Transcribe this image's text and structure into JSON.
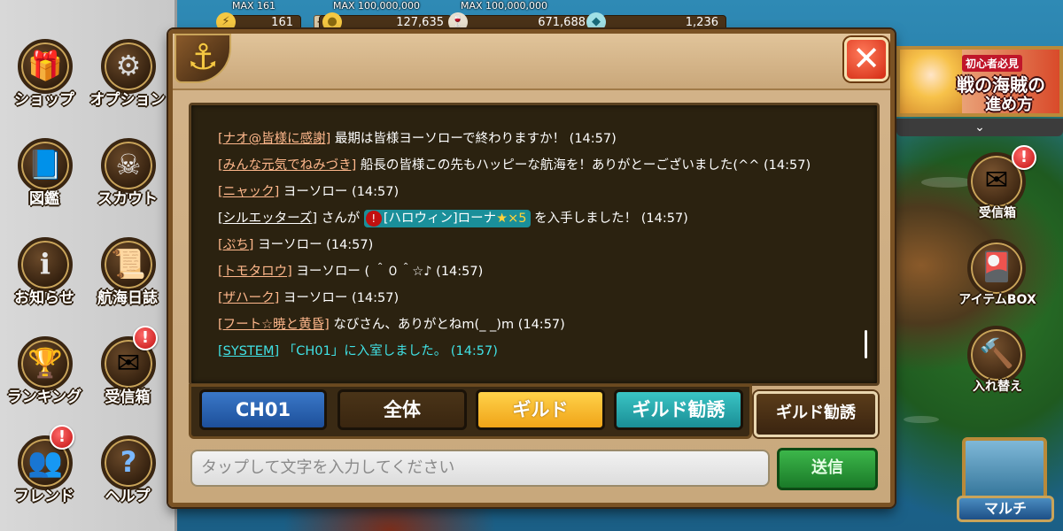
{
  "topbar": {
    "stamina": {
      "max_label": "MAX 161",
      "value": "161"
    },
    "gold": {
      "max_label": "MAX 100,000,000",
      "value": "127,635"
    },
    "wine": {
      "max_label": "MAX 100,000,000",
      "value": "671,688"
    },
    "gems": {
      "value": "1,236"
    }
  },
  "left_menu": [
    {
      "label": "ショップ",
      "icon": "shop-icon"
    },
    {
      "label": "オプション",
      "icon": "gear-icon"
    },
    {
      "label": "図鑑",
      "icon": "book-icon"
    },
    {
      "label": "スカウト",
      "icon": "pirate-flag-icon"
    },
    {
      "label": "お知らせ",
      "icon": "info-icon"
    },
    {
      "label": "航海日誌",
      "icon": "logbook-icon"
    },
    {
      "label": "ランキング",
      "icon": "trophy-icon"
    },
    {
      "label": "受信箱",
      "icon": "mail-icon",
      "badge": "!"
    },
    {
      "label": "フレンド",
      "icon": "friends-icon",
      "badge": "!"
    },
    {
      "label": "ヘルプ",
      "icon": "help-icon"
    }
  ],
  "banner": {
    "tag": "初心者必見",
    "line1": "戦の海賊の",
    "line2": "進め方"
  },
  "banner_toggle": "⌄",
  "right_menu": [
    {
      "label": "受信箱",
      "icon": "mail-icon",
      "badge": "!"
    },
    {
      "label": "アイテムBOX",
      "icon": "item-box-icon"
    },
    {
      "label": "入れ替え",
      "icon": "hammer-icon"
    }
  ],
  "multi": {
    "label": "マルチ"
  },
  "chat": {
    "messages": [
      {
        "name": "[ナオ@皆様に感謝]",
        "text": " 最期は皆様ヨーソローで終わりますか！ (14:57)"
      },
      {
        "name": "[みんな元気でねみづき]",
        "text": " 船長の皆様この先もハッピーな航海を！ありがとーございました(^^ (14:57)"
      },
      {
        "name": "[ニャック]",
        "text": " ヨーソロー (14:57)"
      },
      {
        "name": "[シルエッターズ]",
        "text_before": " さんが ",
        "item": "[ハロウィン]ローナ",
        "item_stars": "★×5",
        "text_after": " を入手しました！ (14:57)"
      },
      {
        "name": "[ぷち]",
        "text": " ヨーソロー (14:57)"
      },
      {
        "name": "[トモタロウ]",
        "text": " ヨーソロー ( ＾０＾☆♪ (14:57)"
      },
      {
        "name": "[ザハーク]",
        "text": " ヨーソロー (14:57)"
      },
      {
        "name": "[フート☆暁と黄昏]",
        "text": " なびさん、ありがとねm(_ _)m (14:57)"
      },
      {
        "name": "[SYSTEM]",
        "text": " 「CH01」に入室しました。 (14:57)"
      }
    ],
    "tabs": {
      "ch01": "CH01",
      "all": "全体",
      "guild": "ギルド",
      "recruit": "ギルド勧誘"
    },
    "active_tab": "CH01",
    "side_button": "ギルド勧誘",
    "input_placeholder": "タップして文字を入力してください",
    "send_label": "送信"
  },
  "colors": {
    "name_link": "#ffb88c",
    "system": "#40e2e6",
    "tab_ch01": "#2a64b4",
    "tab_guild": "#f5b82a",
    "tab_recruit": "#24a8ae",
    "send": "#2a9a38"
  }
}
